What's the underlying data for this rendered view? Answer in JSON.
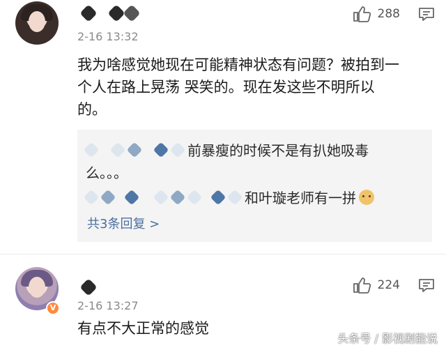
{
  "comments": [
    {
      "time": "2-16 13:32",
      "likes": "288",
      "text_lines": [
        "我为啥感觉她现在可能精神状态有问题？被拍到一",
        "个人在路上晃荡 哭笑的。现在发这些不明所以",
        "的。"
      ],
      "replies": {
        "reply1_line1": "前暴瘦的时候不是有扒她吸毒",
        "reply1_line2": "么。。。",
        "reply2": "和叶璇老师有一拼",
        "more": "共3条回复 >"
      }
    },
    {
      "time": "2-16 13:27",
      "likes": "224",
      "text": "有点不大正常的感觉"
    }
  ],
  "watermark": "头条号 / 影视剧能说",
  "icons": {
    "like": "thumbs-up-icon",
    "reply": "comment-bubble-icon",
    "vip": "v-badge-icon"
  }
}
